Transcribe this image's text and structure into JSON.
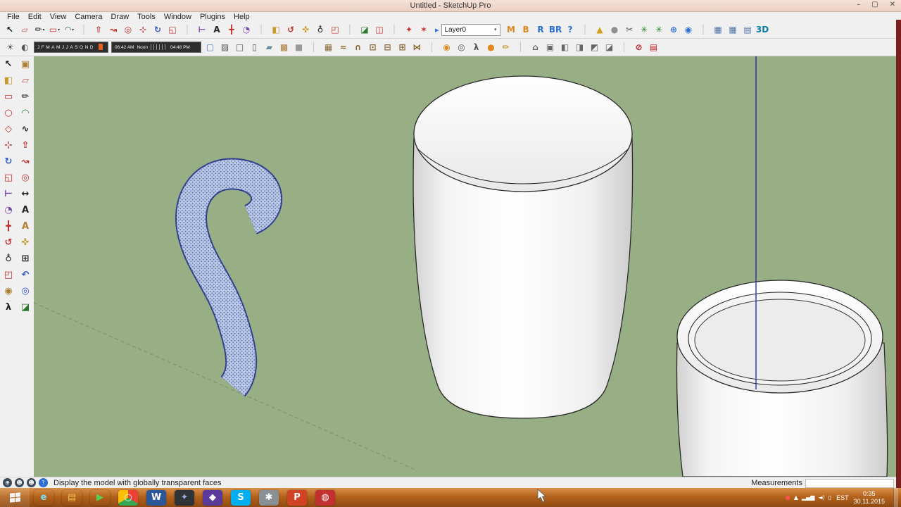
{
  "window": {
    "title": "Untitled - SketchUp Pro",
    "minimize": "–",
    "maximize": "▢",
    "close": "✕"
  },
  "menu": {
    "items": [
      "File",
      "Edit",
      "View",
      "Camera",
      "Draw",
      "Tools",
      "Window",
      "Plugins",
      "Help"
    ]
  },
  "toolbar_main": {
    "group_a": [
      {
        "name": "select-tool",
        "glyph": "↖",
        "color": "#1a1a1a",
        "inter": "true"
      },
      {
        "name": "eraser-tool",
        "glyph": "▱",
        "color": "#c05858",
        "inter": "true"
      },
      {
        "name": "line-tool",
        "glyph": "✏",
        "color": "#222222",
        "caret": "▾",
        "inter": "true"
      },
      {
        "name": "rectangle-tool",
        "glyph": "▭",
        "color": "#c03030",
        "caret": "▾",
        "inter": "true"
      },
      {
        "name": "arc-tool",
        "glyph": "◠",
        "color": "#2a7a2a",
        "caret": "▾",
        "inter": "true"
      },
      {
        "name": "toolbar-separator",
        "glyph": "│",
        "color": "#c4c4c4",
        "inter": "false"
      },
      {
        "name": "push-pull-tool",
        "glyph": "⇧",
        "color": "#c03030",
        "inter": "true"
      },
      {
        "name": "follow-me-tool",
        "glyph": "↝",
        "color": "#c03030",
        "inter": "true"
      },
      {
        "name": "offset-tool",
        "glyph": "◎",
        "color": "#c03030",
        "inter": "true"
      },
      {
        "name": "move-tool",
        "glyph": "⊹",
        "color": "#c03030",
        "inter": "true"
      },
      {
        "name": "rotate-tool",
        "glyph": "↻",
        "color": "#3355cc",
        "inter": "true"
      },
      {
        "name": "scale-tool",
        "glyph": "◱",
        "color": "#c03030",
        "inter": "true"
      },
      {
        "name": "toolbar-separator",
        "glyph": "│",
        "color": "#c4c4c4",
        "inter": "false"
      },
      {
        "name": "tape-measure-tool",
        "glyph": "⊢",
        "color": "#7744aa",
        "inter": "true"
      },
      {
        "name": "text-tool",
        "glyph": "A",
        "color": "#222222",
        "inter": "true"
      },
      {
        "name": "axes-tool",
        "glyph": "╋",
        "color": "#c03030",
        "inter": "true"
      },
      {
        "name": "protractor-tool",
        "glyph": "◔",
        "color": "#7744aa",
        "inter": "true"
      },
      {
        "name": "toolbar-separator",
        "glyph": "│",
        "color": "#c4c4c4",
        "inter": "false"
      },
      {
        "name": "paint-bucket-tool",
        "glyph": "◧",
        "color": "#c8982a",
        "inter": "true"
      },
      {
        "name": "orbit-tool",
        "glyph": "↺",
        "color": "#c03030",
        "inter": "true"
      },
      {
        "name": "pan-tool",
        "glyph": "✜",
        "color": "#c8982a",
        "inter": "true"
      },
      {
        "name": "zoom-tool",
        "glyph": "♁",
        "color": "#222222",
        "inter": "true"
      },
      {
        "name": "zoom-extents-tool",
        "glyph": "◰",
        "color": "#c03030",
        "inter": "true"
      },
      {
        "name": "toolbar-separator",
        "glyph": "│",
        "color": "#c4c4c4",
        "inter": "false"
      },
      {
        "name": "section-plane-tool",
        "glyph": "◪",
        "color": "#2a7a2a",
        "inter": "true"
      },
      {
        "name": "section-cuts-toggle",
        "glyph": "◫",
        "color": "#c03030",
        "inter": "true"
      },
      {
        "name": "toolbar-separator",
        "glyph": "│",
        "color": "#c4c4c4",
        "inter": "false"
      },
      {
        "name": "plugin-button-1",
        "glyph": "✦",
        "color": "#c03030",
        "inter": "true"
      },
      {
        "name": "plugin-button-2",
        "glyph": "✶",
        "color": "#c03030",
        "inter": "true"
      }
    ],
    "layer": {
      "icon_glyph": "▸",
      "value": "Layer0",
      "caret": "▾"
    },
    "group_b": [
      {
        "name": "plugin-badge-m",
        "glyph": "M",
        "color": "#e08820",
        "inter": "true"
      },
      {
        "name": "plugin-badge-b",
        "glyph": "B",
        "color": "#e08820",
        "inter": "true"
      },
      {
        "name": "plugin-badge-r",
        "glyph": "R",
        "color": "#2a6fd4",
        "inter": "true"
      },
      {
        "name": "plugin-badge-br",
        "glyph": "BR",
        "color": "#2a6fd4",
        "inter": "true"
      },
      {
        "name": "plugin-help-badge",
        "glyph": "?",
        "color": "#2a6fd4",
        "inter": "true"
      },
      {
        "name": "toolbar-separator",
        "glyph": "│",
        "color": "#c4c4c4",
        "inter": "false"
      },
      {
        "name": "plugin-cone-tool",
        "glyph": "▲",
        "color": "#d4a017",
        "inter": "true"
      },
      {
        "name": "plugin-sphere-tool",
        "glyph": "●",
        "color": "#909090",
        "inter": "true"
      },
      {
        "name": "plugin-scissors-tool",
        "glyph": "✂",
        "color": "#606060",
        "inter": "true"
      },
      {
        "name": "plugin-garden-tool-1",
        "glyph": "✳",
        "color": "#2a8a2a",
        "inter": "true"
      },
      {
        "name": "plugin-garden-tool-2",
        "glyph": "✳",
        "color": "#2a8a2a",
        "inter": "true"
      },
      {
        "name": "plugin-globe-tool",
        "glyph": "⊕",
        "color": "#2a6fd4",
        "inter": "true"
      },
      {
        "name": "plugin-info-tool",
        "glyph": "◉",
        "color": "#2a6fd4",
        "inter": "true"
      },
      {
        "name": "toolbar-separator",
        "glyph": "│",
        "color": "#c4c4c4",
        "inter": "false"
      },
      {
        "name": "grid-toolbar-1",
        "glyph": "▦",
        "color": "#5577aa",
        "inter": "true"
      },
      {
        "name": "grid-toolbar-2",
        "glyph": "▦",
        "color": "#5577aa",
        "inter": "true"
      },
      {
        "name": "grid-toolbar-3",
        "glyph": "▤",
        "color": "#5577aa",
        "inter": "true"
      },
      {
        "name": "badge-3d",
        "glyph": "3D",
        "color": "#0a7ca8",
        "inter": "true"
      }
    ]
  },
  "toolbar_shadows": {
    "icons_left": [
      {
        "name": "shadow-settings-button",
        "glyph": "☀",
        "color": "#555555",
        "inter": "true"
      },
      {
        "name": "shadow-toggle-button",
        "glyph": "◐",
        "color": "#555555",
        "inter": "true"
      }
    ],
    "months": "JFMAMJJASOND",
    "time_start": "06:42 AM",
    "time_noon": "Noon",
    "time_end": "04:48 PM",
    "icons_right": [
      {
        "name": "xray-mode-button",
        "glyph": "▢",
        "color": "#4a7ab5",
        "inter": "true"
      },
      {
        "name": "back-edges-button",
        "glyph": "▨",
        "color": "#555555",
        "inter": "true"
      },
      {
        "name": "wireframe-button",
        "glyph": "□",
        "color": "#555555",
        "inter": "true"
      },
      {
        "name": "hidden-line-button",
        "glyph": "▯",
        "color": "#555555",
        "inter": "true"
      },
      {
        "name": "shaded-button",
        "glyph": "▰",
        "color": "#6a8aa0",
        "inter": "true"
      },
      {
        "name": "shaded-textures-button",
        "glyph": "▩",
        "color": "#a87838",
        "inter": "true"
      },
      {
        "name": "monochrome-button",
        "glyph": "■",
        "color": "#999999",
        "inter": "true"
      },
      {
        "name": "toolbar-separator",
        "glyph": "│",
        "color": "#c4c4c4",
        "inter": "false"
      },
      {
        "name": "sandbox-from-scratch",
        "glyph": "▦",
        "color": "#8a6a3a",
        "inter": "true"
      },
      {
        "name": "sandbox-from-contours",
        "glyph": "≈",
        "color": "#8a6a3a",
        "inter": "true"
      },
      {
        "name": "sandbox-smoove",
        "glyph": "∩",
        "color": "#8a6a3a",
        "inter": "true"
      },
      {
        "name": "sandbox-stamp",
        "glyph": "⊡",
        "color": "#8a6a3a",
        "inter": "true"
      },
      {
        "name": "sandbox-drape",
        "glyph": "⊟",
        "color": "#8a6a3a",
        "inter": "true"
      },
      {
        "name": "sandbox-add-detail",
        "glyph": "⊞",
        "color": "#8a6a3a",
        "inter": "true"
      },
      {
        "name": "sandbox-flip-edge",
        "glyph": "⋈",
        "color": "#8a6a3a",
        "inter": "true"
      },
      {
        "name": "toolbar-separator",
        "glyph": "│",
        "color": "#c4c4c4",
        "inter": "false"
      },
      {
        "name": "position-camera-button",
        "glyph": "◉",
        "color": "#e08820",
        "inter": "true"
      },
      {
        "name": "look-around-button",
        "glyph": "◎",
        "color": "#555555",
        "inter": "true"
      },
      {
        "name": "walk-button",
        "glyph": "λ",
        "color": "#555555",
        "inter": "true"
      },
      {
        "name": "camera-orange-button",
        "glyph": "●",
        "color": "#e08820",
        "inter": "true"
      },
      {
        "name": "annotate-button",
        "glyph": "✏",
        "color": "#b8860b",
        "inter": "true"
      },
      {
        "name": "toolbar-separator",
        "glyph": "│",
        "color": "#c4c4c4",
        "inter": "false"
      },
      {
        "name": "view-iso-button",
        "glyph": "⌂",
        "color": "#666666",
        "inter": "true"
      },
      {
        "name": "view-top-button",
        "glyph": "▣",
        "color": "#666666",
        "inter": "true"
      },
      {
        "name": "view-front-button",
        "glyph": "◧",
        "color": "#666666",
        "inter": "true"
      },
      {
        "name": "view-right-button",
        "glyph": "◨",
        "color": "#666666",
        "inter": "true"
      },
      {
        "name": "view-back-button",
        "glyph": "◩",
        "color": "#666666",
        "inter": "true"
      },
      {
        "name": "view-left-button",
        "glyph": "◪",
        "color": "#666666",
        "inter": "true"
      },
      {
        "name": "toolbar-separator",
        "glyph": "│",
        "color": "#c4c4c4",
        "inter": "false"
      },
      {
        "name": "disable-snap-button",
        "glyph": "⊘",
        "color": "#c02020",
        "inter": "true"
      },
      {
        "name": "bricks-material-button",
        "glyph": "▤",
        "color": "#c02020",
        "inter": "true"
      }
    ]
  },
  "palette": {
    "tools": [
      {
        "name": "select-tool",
        "glyph": "↖",
        "color": "#1a1a1a",
        "inter": "true"
      },
      {
        "name": "make-component-tool",
        "glyph": "▣",
        "color": "#b08030",
        "inter": "true"
      },
      {
        "name": "paint-bucket-tool",
        "glyph": "◧",
        "color": "#c8982a",
        "inter": "true"
      },
      {
        "name": "eraser-tool",
        "glyph": "▱",
        "color": "#c05858",
        "inter": "true"
      },
      {
        "name": "rectangle-tool",
        "glyph": "▭",
        "color": "#c03030",
        "inter": "true"
      },
      {
        "name": "line-tool",
        "glyph": "✏",
        "color": "#222222",
        "inter": "true"
      },
      {
        "name": "circle-tool",
        "glyph": "○",
        "color": "#c03030",
        "inter": "true"
      },
      {
        "name": "arc-tool",
        "glyph": "◠",
        "color": "#2a7a2a",
        "inter": "true"
      },
      {
        "name": "polygon-tool",
        "glyph": "◇",
        "color": "#c03030",
        "inter": "true"
      },
      {
        "name": "freehand-tool",
        "glyph": "∿",
        "color": "#222222",
        "inter": "true"
      },
      {
        "name": "move-tool",
        "glyph": "⊹",
        "color": "#c03030",
        "inter": "true"
      },
      {
        "name": "push-pull-tool",
        "glyph": "⇧",
        "color": "#c03030",
        "inter": "true"
      },
      {
        "name": "rotate-tool",
        "glyph": "↻",
        "color": "#3355cc",
        "inter": "true"
      },
      {
        "name": "follow-me-tool",
        "glyph": "↝",
        "color": "#c03030",
        "inter": "true"
      },
      {
        "name": "scale-tool",
        "glyph": "◱",
        "color": "#c03030",
        "inter": "true"
      },
      {
        "name": "offset-tool",
        "glyph": "◎",
        "color": "#c03030",
        "inter": "true"
      },
      {
        "name": "tape-measure-tool",
        "glyph": "⊢",
        "color": "#7744aa",
        "inter": "true"
      },
      {
        "name": "dimension-tool",
        "glyph": "↔",
        "color": "#222222",
        "inter": "true"
      },
      {
        "name": "protractor-tool",
        "glyph": "◔",
        "color": "#7744aa",
        "inter": "true"
      },
      {
        "name": "text-tool",
        "glyph": "A",
        "color": "#222222",
        "inter": "true"
      },
      {
        "name": "axes-tool",
        "glyph": "╋",
        "color": "#c03030",
        "inter": "true"
      },
      {
        "name": "3d-text-tool",
        "glyph": "A",
        "color": "#b08030",
        "inter": "true"
      },
      {
        "name": "orbit-tool",
        "glyph": "↺",
        "color": "#c03030",
        "inter": "true"
      },
      {
        "name": "pan-tool",
        "glyph": "✜",
        "color": "#c8982a",
        "inter": "true"
      },
      {
        "name": "zoom-tool",
        "glyph": "♁",
        "color": "#222222",
        "inter": "true"
      },
      {
        "name": "zoom-window-tool",
        "glyph": "⊞",
        "color": "#222222",
        "inter": "true"
      },
      {
        "name": "zoom-extents-tool",
        "glyph": "◰",
        "color": "#c03030",
        "inter": "true"
      },
      {
        "name": "previous-view-tool",
        "glyph": "↶",
        "color": "#3355cc",
        "inter": "true"
      },
      {
        "name": "position-camera-tool",
        "glyph": "◉",
        "color": "#b08030",
        "inter": "true"
      },
      {
        "name": "look-around-tool",
        "glyph": "◎",
        "color": "#3355cc",
        "inter": "true"
      },
      {
        "name": "walk-tool",
        "glyph": "λ",
        "color": "#222222",
        "inter": "true"
      },
      {
        "name": "section-plane-tool",
        "glyph": "◪",
        "color": "#2a7a2a",
        "inter": "true"
      }
    ]
  },
  "viewport": {
    "background": "#98ae85",
    "axis_color": "#2020b0",
    "selection_fill": "#b9c6e2",
    "selection_edge": "#31418c"
  },
  "status": {
    "icons": [
      {
        "name": "geolocate-icon",
        "glyph": "⊕",
        "bg": "#3c4c5c",
        "inter": "true"
      },
      {
        "name": "credit-icon",
        "glyph": "☻",
        "bg": "#3c4c5c",
        "inter": "true"
      },
      {
        "name": "signin-icon",
        "glyph": "☻",
        "bg": "#3c4c5c",
        "inter": "true"
      },
      {
        "name": "help-icon",
        "glyph": "?",
        "bg": "#2a6fd4",
        "inter": "true"
      }
    ],
    "hint": "Display the model with globally transparent faces",
    "measurements_label": "Measurements"
  },
  "taskbar": {
    "apps": [
      {
        "name": "taskbar-ie",
        "glyph": "e",
        "bg": "transparent",
        "fg": "#7adcf8",
        "inter": "true"
      },
      {
        "name": "taskbar-explorer",
        "glyph": "▤",
        "bg": "transparent",
        "fg": "#f0c050",
        "inter": "true"
      },
      {
        "name": "taskbar-media-app",
        "glyph": "▶",
        "bg": "transparent",
        "fg": "#58d058",
        "inter": "true"
      },
      {
        "name": "taskbar-chrome",
        "glyph": "○",
        "bg": "conic-gradient(#ea4335 0deg 120deg,#34a853 120deg 240deg,#fbbc05 240deg 360deg)",
        "fg": "#ffffff",
        "inter": "true"
      },
      {
        "name": "taskbar-word",
        "glyph": "W",
        "bg": "#2b579a",
        "fg": "#ffffff",
        "inter": "true"
      },
      {
        "name": "taskbar-dark-app",
        "glyph": "✦",
        "bg": "#303438",
        "fg": "#99aadd",
        "inter": "true"
      },
      {
        "name": "taskbar-purple-app",
        "glyph": "◆",
        "bg": "#5a3a9a",
        "fg": "#ffffff",
        "inter": "true"
      },
      {
        "name": "taskbar-skype",
        "glyph": "S",
        "bg": "#00aff0",
        "fg": "#ffffff",
        "inter": "true"
      },
      {
        "name": "taskbar-tools-app",
        "glyph": "✱",
        "bg": "#8a8f94",
        "fg": "#ffffff",
        "inter": "true"
      },
      {
        "name": "taskbar-powerpoint",
        "glyph": "P",
        "bg": "#d04423",
        "fg": "#ffffff",
        "inter": "true"
      },
      {
        "name": "taskbar-red-app",
        "glyph": "◍",
        "bg": "#c23030",
        "fg": "#ffffff",
        "inter": "true"
      }
    ],
    "tray": [
      {
        "name": "tray-record-icon",
        "glyph": "●",
        "color": "#ff5050",
        "inter": "true"
      },
      {
        "name": "tray-hidden-icons-arrow",
        "glyph": "▲",
        "color": "#ffffff",
        "inter": "true"
      },
      {
        "name": "tray-network-icon",
        "glyph": "▂▄▆",
        "color": "#ffffff",
        "inter": "true"
      },
      {
        "name": "tray-volume-icon",
        "glyph": "◄)",
        "color": "#ffffff",
        "inter": "true"
      },
      {
        "name": "tray-battery-icon",
        "glyph": "▯",
        "color": "#ffffff",
        "inter": "true"
      }
    ],
    "language": "EST",
    "time": "0:35",
    "date": "30.11.2015"
  }
}
